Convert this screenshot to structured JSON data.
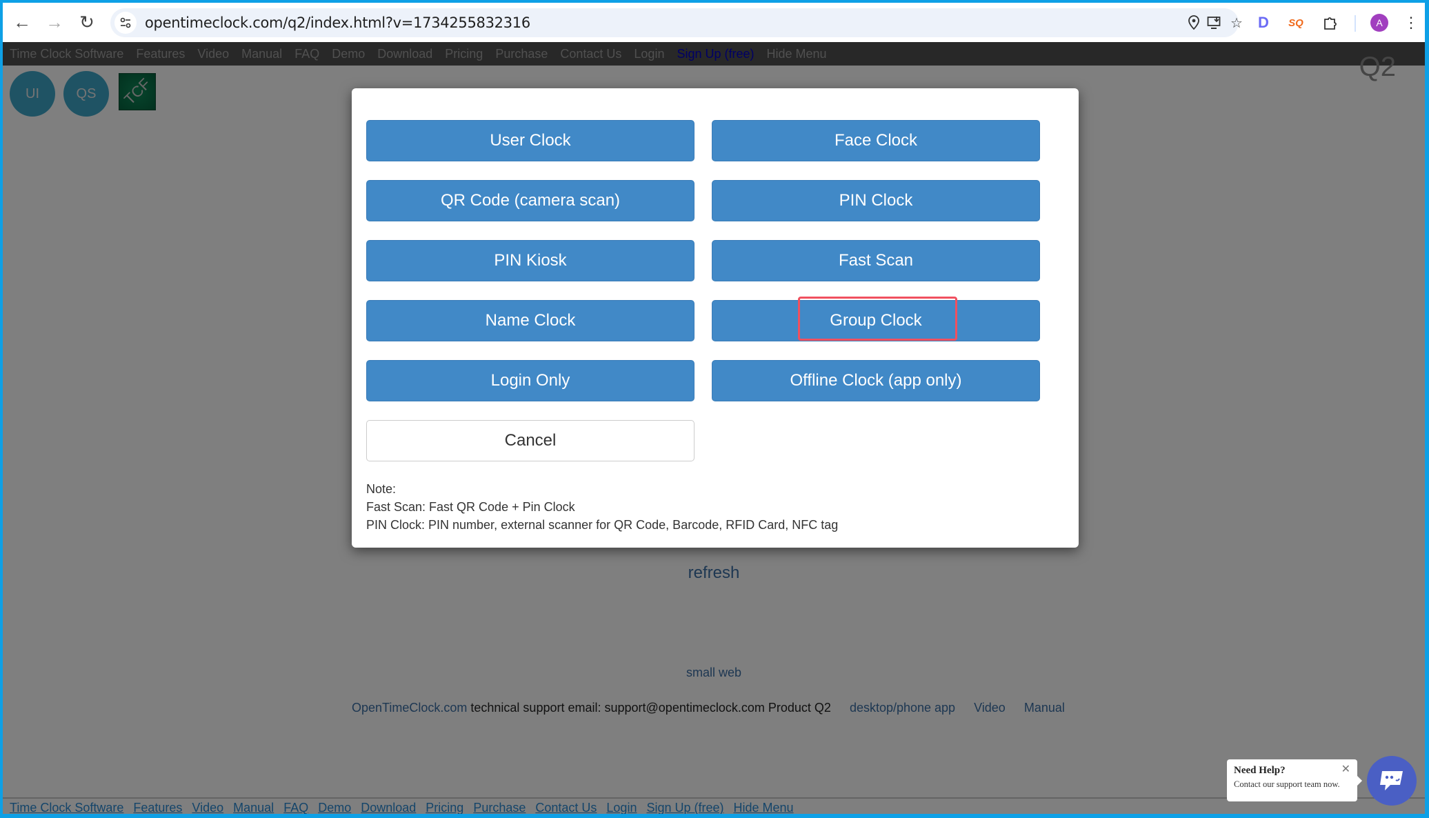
{
  "browser": {
    "url": "opentimeclock.com/q2/index.html?v=1734255832316",
    "avatar_letter": "A",
    "icons": {
      "back": "←",
      "forward": "→",
      "reload": "↻",
      "site_info": "⚙",
      "location": "⌖",
      "install": "⇩",
      "bookmark": "☆",
      "extension_d": "D",
      "extension_sq": "SQ",
      "extensions": "⧉",
      "menu": "⋮"
    }
  },
  "top_menu": {
    "items": [
      "Time Clock Software",
      "Features",
      "Video",
      "Manual",
      "FAQ",
      "Demo",
      "Download",
      "Pricing",
      "Purchase",
      "Contact Us",
      "Login",
      "Sign Up (free)",
      "Hide Menu"
    ]
  },
  "header": {
    "circle_buttons": [
      "UI",
      "QS"
    ],
    "logo_text": "TCF",
    "product_label": "Q2"
  },
  "modal": {
    "buttons": [
      {
        "label": "User Clock"
      },
      {
        "label": "Face Clock"
      },
      {
        "label": "QR Code (camera scan)"
      },
      {
        "label": "PIN Clock"
      },
      {
        "label": "PIN Kiosk"
      },
      {
        "label": "Fast Scan"
      },
      {
        "label": "Name Clock"
      },
      {
        "label": "Group Clock"
      },
      {
        "label": "Login Only"
      },
      {
        "label": "Offline Clock (app only)"
      }
    ],
    "cancel_label": "Cancel",
    "highlighted": "Group Clock",
    "note_lines": [
      "Note:",
      "Fast Scan: Fast QR Code + Pin Clock",
      "PIN Clock: PIN number, external scanner for QR Code, Barcode, RFID Card, NFC tag"
    ]
  },
  "page": {
    "refresh_label": "refresh",
    "small_web_label": "small web",
    "footer": {
      "site_link": "OpenTimeClock.com",
      "support_text": " technical support email: support@opentimeclock.com Product Q2",
      "app_link": "desktop/phone app",
      "video_link": "Video",
      "manual_link": "Manual"
    }
  },
  "bottom_menu": {
    "items": [
      "Time Clock Software",
      "Features",
      "Video",
      "Manual",
      "FAQ",
      "Demo",
      "Download",
      "Pricing",
      "Purchase",
      "Contact Us",
      "Login",
      "Sign Up (free)",
      "Hide Menu"
    ]
  },
  "help_widget": {
    "title": "Need Help?",
    "subtitle": "Contact our support team now.",
    "close": "✕"
  },
  "colors": {
    "button_blue": "#4189c7",
    "highlight_red": "#f0505f",
    "frame_blue": "#0ea0e6",
    "chat_blue": "#4a5fc4"
  }
}
